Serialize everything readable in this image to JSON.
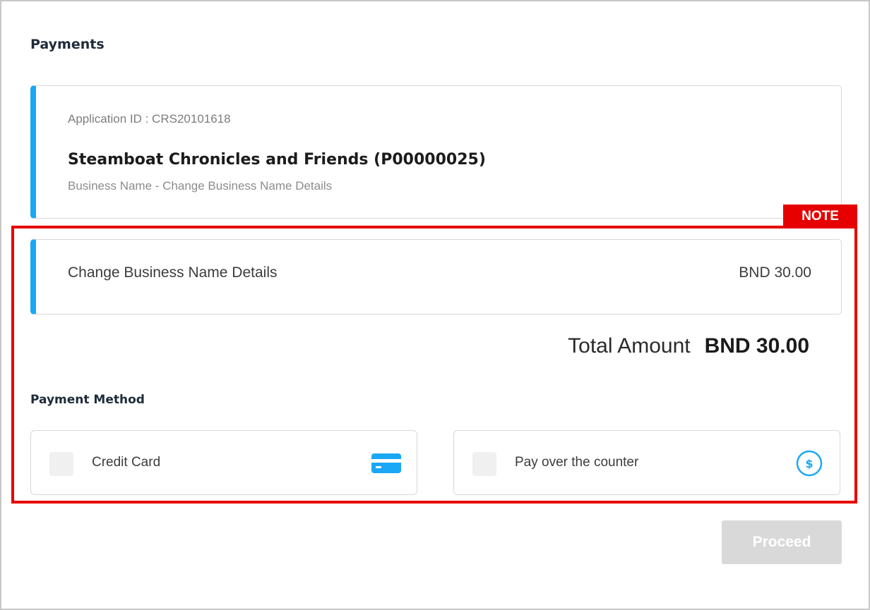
{
  "page": {
    "title": "Payments"
  },
  "application": {
    "id_text": "Application ID : CRS20101618",
    "name": "Steamboat Chronicles and Friends (P00000025)",
    "description": "Business Name - Change Business Name Details"
  },
  "annotation": {
    "label": "NOTE",
    "color": "#e60000"
  },
  "fee": {
    "label": "Change Business Name Details",
    "amount": "BND 30.00"
  },
  "total": {
    "label": "Total Amount",
    "value": "BND 30.00"
  },
  "payment_method": {
    "title": "Payment Method",
    "options": [
      {
        "label": "Credit Card",
        "icon": "credit-card-icon",
        "checked": false
      },
      {
        "label": "Pay over the counter",
        "icon": "dollar-circle-icon",
        "checked": false
      }
    ]
  },
  "actions": {
    "proceed_label": "Proceed",
    "proceed_enabled": false
  },
  "colors": {
    "accent": "#1aa7f5",
    "disabled_button": "#d9d9d9"
  }
}
